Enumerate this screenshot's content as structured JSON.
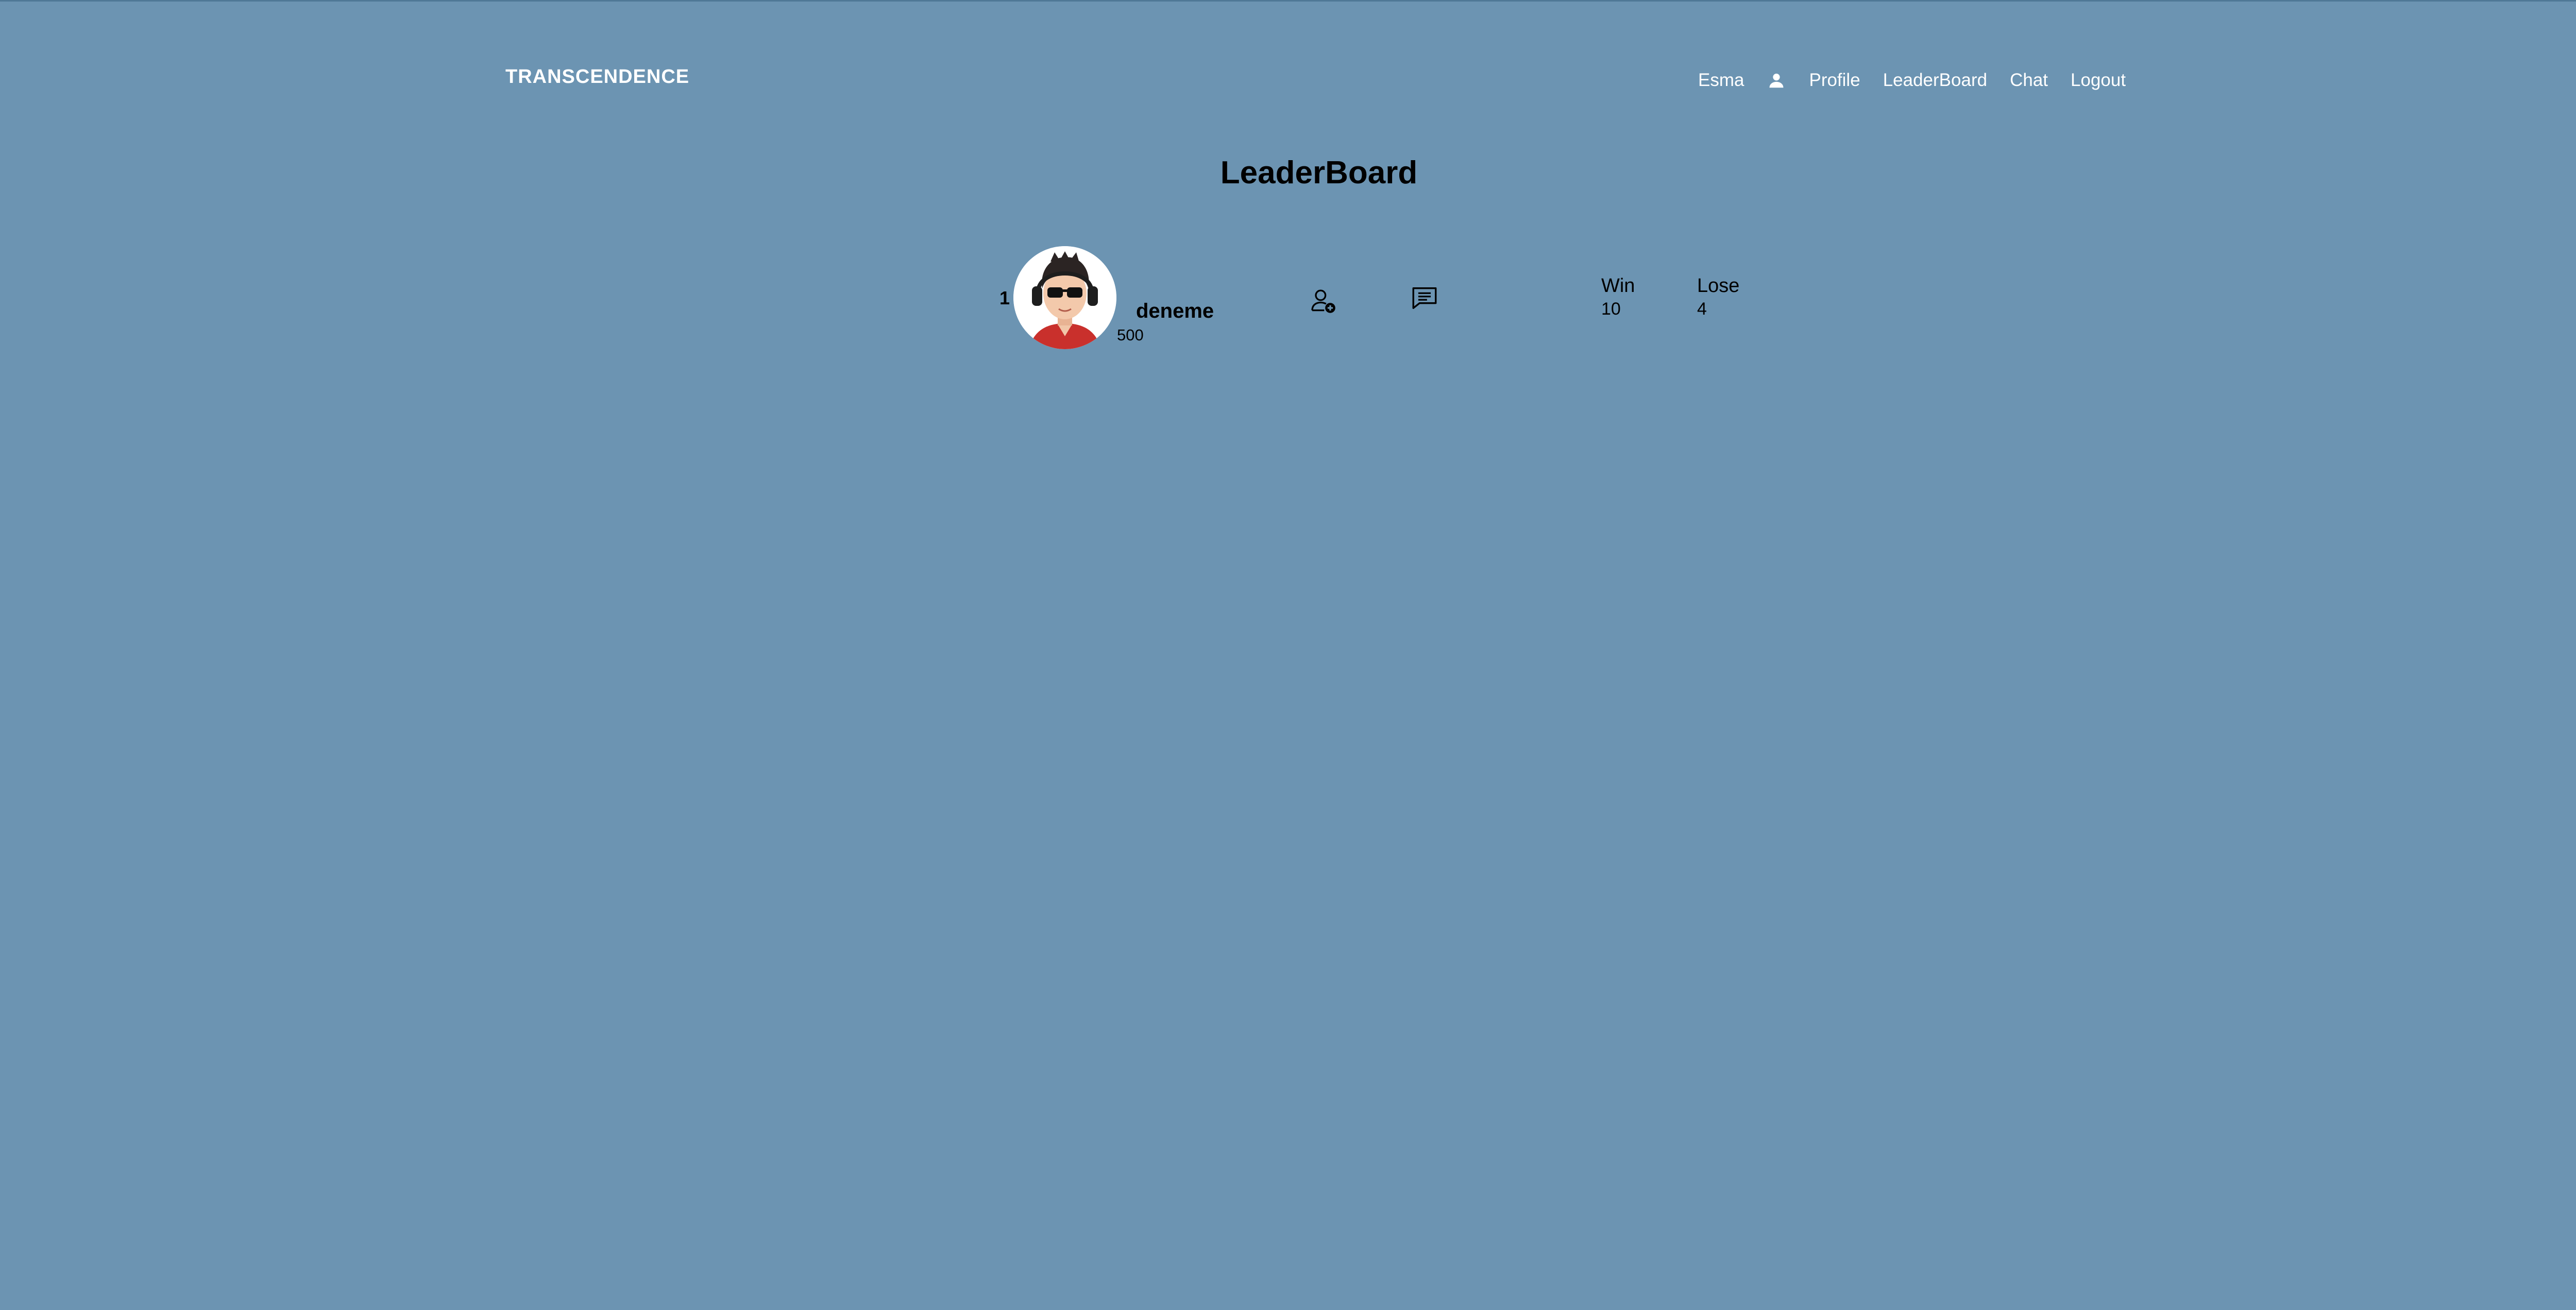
{
  "header": {
    "brand": "TRANSCENDENCE",
    "nav": {
      "username": "Esma",
      "user_icon": "user-icon",
      "profile": "Profile",
      "leaderboard": "LeaderBoard",
      "chat": "Chat",
      "logout": "Logout"
    }
  },
  "main": {
    "title": "LeaderBoard",
    "rows": [
      {
        "rank": "1",
        "avatar_icon": "avatar-cartoon-boy-sunglasses",
        "username": "deneme",
        "score": "500",
        "add_friend_icon": "add-friend-icon",
        "message_icon": "chat-bubble-icon",
        "win_label": "Win",
        "win_value": "10",
        "lose_label": "Lose",
        "lose_value": "4"
      }
    ]
  },
  "colors": {
    "background": "#6c94b2",
    "text": "#000000",
    "nav_text": "#ffffff"
  }
}
